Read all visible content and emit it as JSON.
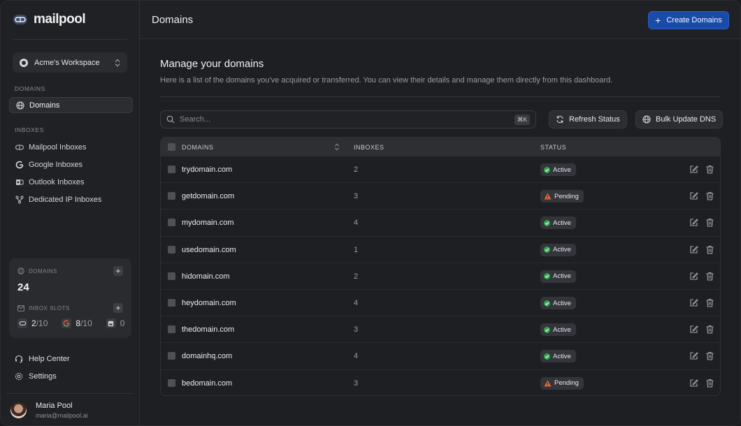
{
  "app": {
    "logo_text": "mailpool"
  },
  "sidebar": {
    "workspace": "Acme's Workspace",
    "domains_section": "DOMAINS",
    "domains_item": "Domains",
    "inboxes_section": "INBOXES",
    "inbox_items": [
      {
        "label": "Mailpool Inboxes",
        "icon": "mailpool-icon"
      },
      {
        "label": "Google Inboxes",
        "icon": "google-icon"
      },
      {
        "label": "Outlook Inboxes",
        "icon": "outlook-icon"
      },
      {
        "label": "Dedicated IP Inboxes",
        "icon": "network-icon"
      }
    ],
    "stats": {
      "domains_label": "DOMAINS",
      "domains_count": "24",
      "slots_label": "INBOX SLOTS",
      "mailpool_used": "2",
      "mailpool_total": "/10",
      "google_used": "8",
      "google_total": "/10",
      "outlook_used": "0"
    },
    "help": "Help Center",
    "settings": "Settings",
    "user": {
      "name": "Maria Pool",
      "email": "maria@mailpool.ai"
    }
  },
  "header": {
    "title": "Domains",
    "create_label": "Create Domains"
  },
  "main": {
    "heading": "Manage your domains",
    "description": "Here is a list of the domains you've acquired or transferred. You can view their details and manage them directly from this dashboard.",
    "search_placeholder": "Search...",
    "shortcut": "⌘K",
    "refresh_label": "Refresh Status",
    "bulk_label": "Bulk Update DNS"
  },
  "table": {
    "headers": {
      "domains": "DOMAINS",
      "inboxes": "INBOXES",
      "status": "STATUS"
    },
    "rows": [
      {
        "domain": "trydomain.com",
        "inboxes": "2",
        "status": "Active"
      },
      {
        "domain": "getdomain.com",
        "inboxes": "3",
        "status": "Pending"
      },
      {
        "domain": "mydomain.com",
        "inboxes": "4",
        "status": "Active"
      },
      {
        "domain": "usedomain.com",
        "inboxes": "1",
        "status": "Active"
      },
      {
        "domain": "hidomain.com",
        "inboxes": "2",
        "status": "Active"
      },
      {
        "domain": "heydomain.com",
        "inboxes": "4",
        "status": "Active"
      },
      {
        "domain": "thedomain.com",
        "inboxes": "3",
        "status": "Active"
      },
      {
        "domain": "domainhq.com",
        "inboxes": "4",
        "status": "Active"
      },
      {
        "domain": "bedomain.com",
        "inboxes": "3",
        "status": "Pending"
      }
    ]
  },
  "colors": {
    "accent": "#1b4ba8",
    "active": "#2ea84f",
    "pending": "#e0683a"
  }
}
